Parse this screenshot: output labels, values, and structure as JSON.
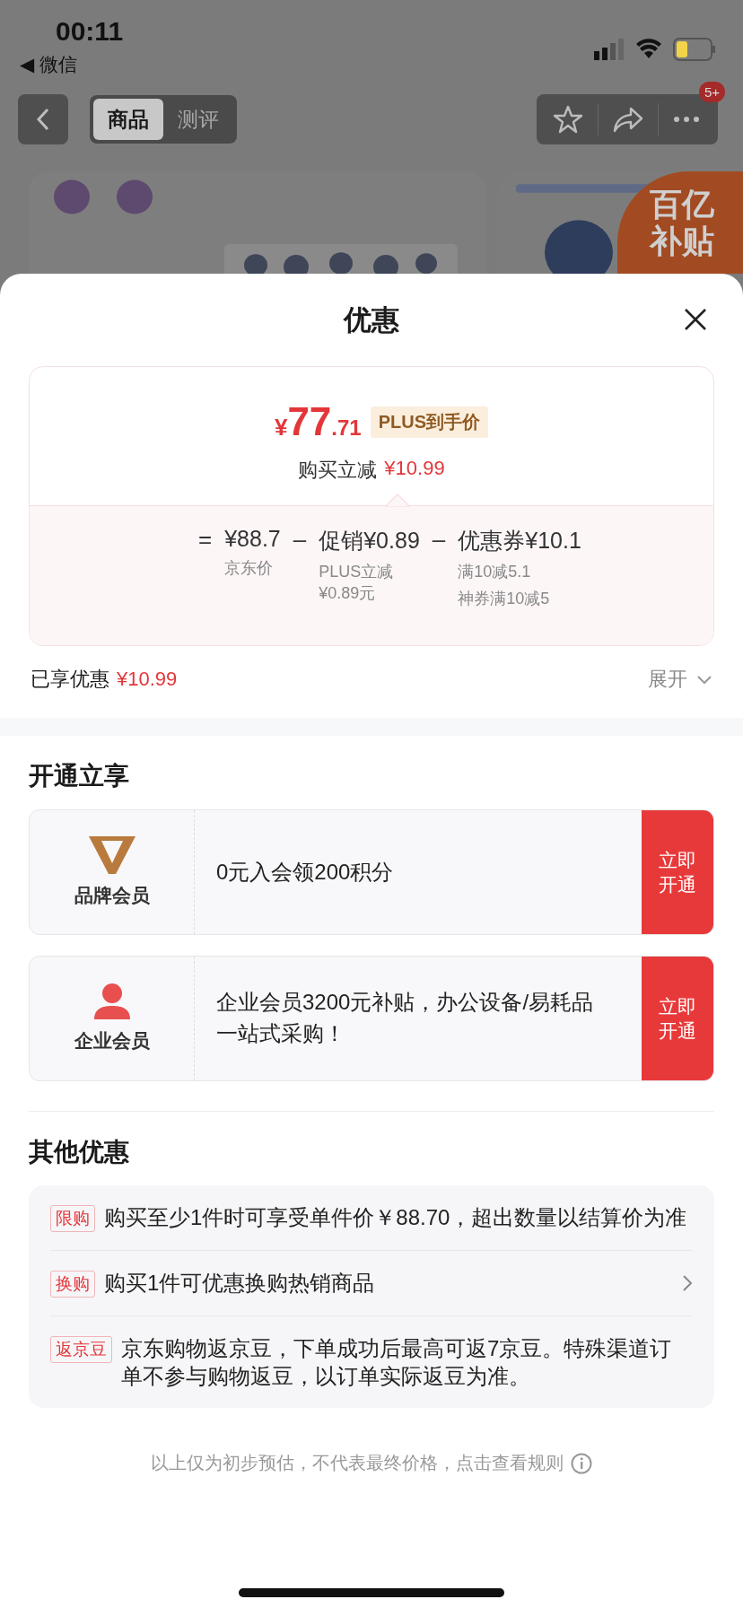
{
  "status_bar": {
    "time": "00:11",
    "back_app": "◀ 微信"
  },
  "nav": {
    "tabs": [
      {
        "label": "商品",
        "selected": true
      },
      {
        "label": "测评",
        "selected": false
      }
    ],
    "badge": "5+"
  },
  "promo_badge": [
    "百亿",
    "补贴"
  ],
  "sheet": {
    "title": "优惠"
  },
  "price_card": {
    "currency": "¥",
    "integer": "77",
    "decimal": ".71",
    "tag": "PLUS到手价",
    "discount_label": "购买立减",
    "discount_value": "¥10.99",
    "terms": [
      {
        "operator": "=",
        "amount": "¥88.7",
        "notes": [
          "京东价"
        ]
      },
      {
        "operator": "–",
        "amount": "促销¥0.89",
        "notes": [
          "PLUS立减 ¥0.89元"
        ]
      },
      {
        "operator": "–",
        "amount": "优惠券¥10.1",
        "notes": [
          "满10减5.1",
          "神券满10减5"
        ]
      }
    ]
  },
  "enjoyed": {
    "label": "已享优惠",
    "value": "¥10.99",
    "expand": "展开"
  },
  "membership": {
    "title": "开通立享",
    "cards": [
      {
        "kind": "brand",
        "name": "品牌会员",
        "desc": "0元入会领200积分",
        "action": "立即开通"
      },
      {
        "kind": "enterprise",
        "name": "企业会员",
        "desc": "企业会员3200元补贴，办公设备/易耗品一站式采购！",
        "action": "立即开通"
      }
    ]
  },
  "other": {
    "title": "其他优惠",
    "items": [
      {
        "tag": "限购",
        "text": "购买至少1件时可享受单件价￥88.70，超出数量以结算价为准",
        "link": false
      },
      {
        "tag": "换购",
        "text": "购买1件可优惠换购热销商品",
        "link": true
      },
      {
        "tag": "返京豆",
        "text": "京东购物返京豆，下单成功后最高可返7京豆。特殊渠道订单不参与购物返豆，以订单实际返豆为准。",
        "link": false
      }
    ]
  },
  "footer": "以上仅为初步预估，不代表最终价格，点击查看规则"
}
